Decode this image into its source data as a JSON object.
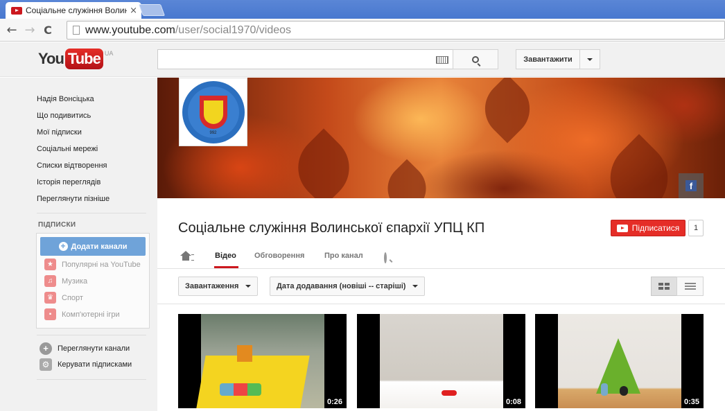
{
  "browser": {
    "tab_title": "Соціальне служіння Волинс",
    "tab_close": "×",
    "url_domain": "www.youtube.com",
    "url_path": "/user/social1970/videos",
    "back": "←",
    "forward": "→",
    "reload": "C"
  },
  "header": {
    "logo_you": "You",
    "logo_tube": "Tube",
    "region": "UA",
    "search_placeholder": "",
    "upload_label": "Завантажити"
  },
  "guide": {
    "links": [
      "Надія Вонсіцька",
      "Що подивитись",
      "Мої підписки",
      "Соціальні мережі",
      "Списки відтворення",
      "Історія переглядів",
      "Переглянути пізніше"
    ],
    "subscriptions_heading": "ПІДПИСКИ",
    "add_channels": "Додати канали",
    "subscription_items": [
      {
        "label": "Популярні на YouTube",
        "icon": "star-icon",
        "glyph": "★"
      },
      {
        "label": "Музика",
        "icon": "headphones-icon",
        "glyph": "♫"
      },
      {
        "label": "Спорт",
        "icon": "trophy-icon",
        "glyph": "♛"
      },
      {
        "label": "Комп'ютерні ігри",
        "icon": "gamepad-icon",
        "glyph": "▪"
      }
    ],
    "browse_channels": "Переглянути канали",
    "manage_subscriptions": "Керувати підписками"
  },
  "channel": {
    "title": "Соціальне служіння Волинської єпархії УПЦ КП",
    "subscribe_label": "Підписатися",
    "subscriber_count": "1",
    "logo_year": "992",
    "facebook_glyph": "f",
    "tabs": [
      "Відео",
      "Обговорення",
      "Про канал"
    ],
    "active_tab": "Відео",
    "filter_uploads": "Завантаження",
    "filter_sort": "Дата додавання (новіші -- старіші)"
  },
  "videos": [
    {
      "duration": "0:26"
    },
    {
      "duration": "0:08"
    },
    {
      "duration": "0:35"
    }
  ],
  "colors": {
    "brand_red": "#cc181e",
    "tab_bar_blue": "#4878cf",
    "add_channel_blue": "#6fa3d9"
  }
}
